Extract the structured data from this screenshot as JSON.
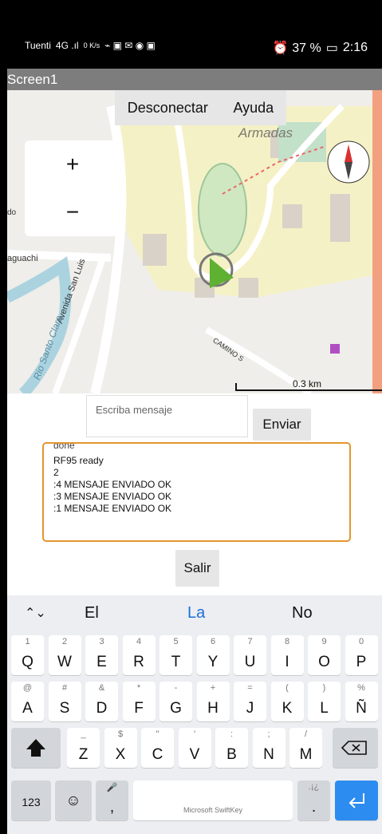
{
  "status": {
    "carrier": "Tuenti",
    "signal": "4G .ıl",
    "net_speed": "0 K/s",
    "icons": "⌁ ▣ ✉ ◉ ▣",
    "alarm": "⏰ 37 %",
    "battery": "▭",
    "time": "2:16"
  },
  "title": "Screen1",
  "top_buttons": {
    "disconnect": "Desconectar",
    "help": "Ayuda"
  },
  "map": {
    "zoom_in": "+",
    "zoom_out": "−",
    "labels": {
      "armadas": "Armadas",
      "aguachi": "aguachi",
      "avenida": "Avenida San Luis",
      "rio": "Rio Santo Clara",
      "camino": "CAMINO S",
      "do": "do"
    },
    "scale": "0.3 km"
  },
  "message": {
    "placeholder": "Escriba mensaje",
    "send": "Enviar"
  },
  "log": {
    "cut": "done",
    "lines": [
      "RF95 ready",
      "2",
      " :4  MENSAJE ENVIADO  OK",
      " :3  MENSAJE ENVIADO  OK",
      " :1  MENSAJE ENVIADO  OK"
    ]
  },
  "exit": "Salir",
  "keyboard": {
    "suggestions": [
      "El",
      "La",
      "No"
    ],
    "row1": [
      [
        "1",
        "Q"
      ],
      [
        "2",
        "W"
      ],
      [
        "3",
        "E"
      ],
      [
        "4",
        "R"
      ],
      [
        "5",
        "T"
      ],
      [
        "6",
        "Y"
      ],
      [
        "7",
        "U"
      ],
      [
        "8",
        "I"
      ],
      [
        "9",
        "O"
      ],
      [
        "0",
        "P"
      ]
    ],
    "row2": [
      [
        "@",
        "A"
      ],
      [
        "#",
        "S"
      ],
      [
        "&",
        "D"
      ],
      [
        "*",
        "F"
      ],
      [
        "-",
        "G"
      ],
      [
        "+",
        "H"
      ],
      [
        "=",
        "J"
      ],
      [
        "(",
        "K"
      ],
      [
        ")",
        "L"
      ],
      [
        "%",
        "Ñ"
      ]
    ],
    "row3": [
      [
        "_",
        "Z"
      ],
      [
        "$",
        "X"
      ],
      [
        "\"",
        "C"
      ],
      [
        "'",
        "V"
      ],
      [
        ":",
        "B"
      ],
      [
        ";",
        "N"
      ],
      [
        "/",
        "M"
      ]
    ],
    "num_key": "123",
    "space_label": "Microsoft SwiftKey",
    "comma": ",",
    "period": ".",
    "period_hint": ".¡¿"
  }
}
